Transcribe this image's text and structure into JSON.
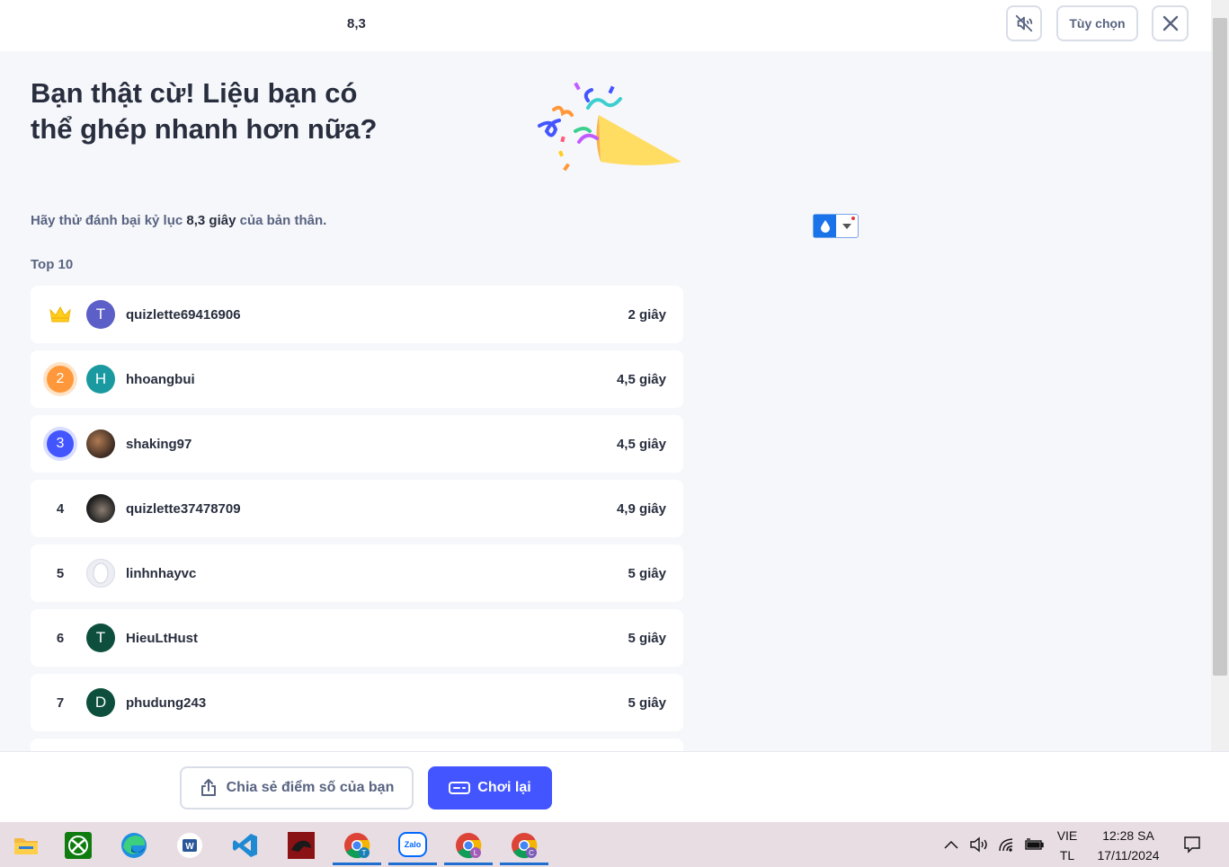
{
  "header": {
    "score": "8,3",
    "mute_icon": "speaker-muted-icon",
    "options_label": "Tùy chọn",
    "close_icon": "close-icon"
  },
  "result": {
    "heading": "Bạn thật cừ! Liệu bạn có thể ghép nhanh hơn nữa?",
    "subtitle_prefix": "Hãy thử đánh bại kỷ lục ",
    "subtitle_record": "8,3 giây",
    "subtitle_suffix": " của bản thân.",
    "leaderboard_title": "Top 10"
  },
  "leaderboard": [
    {
      "rank": "1",
      "initial": "T",
      "name": "quizlette69416906",
      "time": "2 giây"
    },
    {
      "rank": "2",
      "initial": "H",
      "name": "hhoangbui",
      "time": "4,5 giây"
    },
    {
      "rank": "3",
      "initial": "",
      "name": "shaking97",
      "time": "4,5 giây"
    },
    {
      "rank": "4",
      "initial": "",
      "name": "quizlette37478709",
      "time": "4,9 giây"
    },
    {
      "rank": "5",
      "initial": "",
      "name": "linhnhayvc",
      "time": "5 giây"
    },
    {
      "rank": "6",
      "initial": "T",
      "name": "HieuLtHust",
      "time": "5 giây"
    },
    {
      "rank": "7",
      "initial": "D",
      "name": "phudung243",
      "time": "5 giây"
    }
  ],
  "actions": {
    "share_label": "Chia sẻ điểm số của bạn",
    "replay_label": "Chơi lại"
  },
  "taskbar": {
    "apps": [
      "file-explorer-icon",
      "xbox-icon",
      "edge-icon",
      "word-app-icon",
      "vscode-icon",
      "game-app-icon",
      "chrome-T-icon",
      "zalo-icon",
      "chrome-L-icon",
      "chrome-C-icon"
    ],
    "zalo_label": "Zalo",
    "lang_line1": "VIE",
    "lang_line2": "TL",
    "time": "12:28 SA",
    "date": "17/11/2024"
  },
  "colors": {
    "accent": "#4255ff",
    "rank2": "#ff983a",
    "rank3": "#4255ff",
    "crown": "#ffcd1f"
  }
}
